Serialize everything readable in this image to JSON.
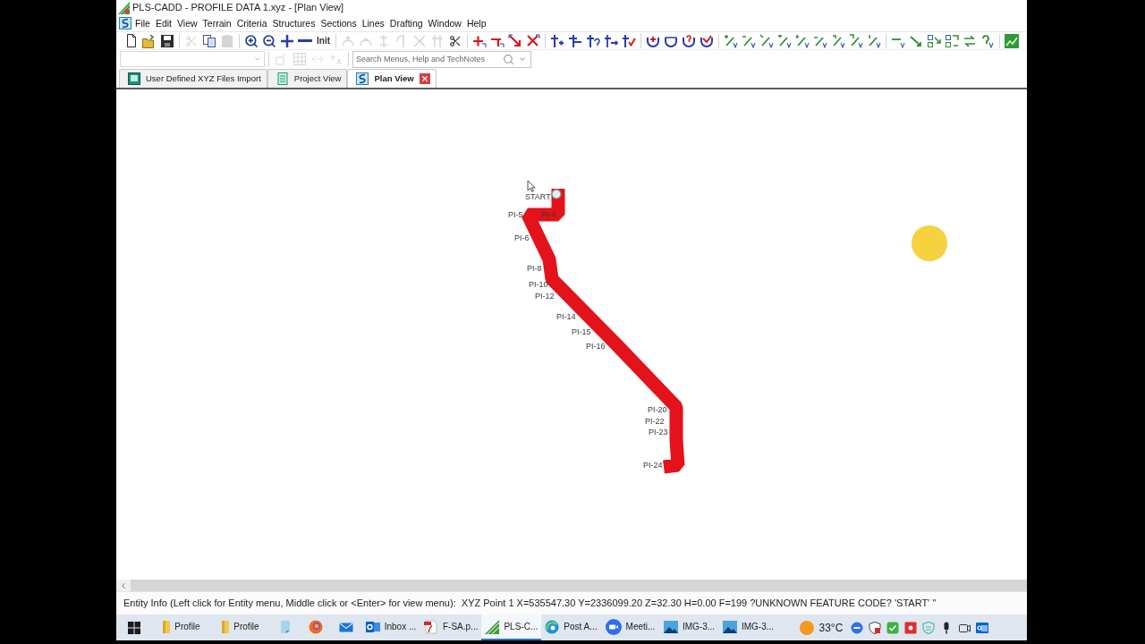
{
  "window": {
    "title": "PLS-CADD - PROFILE DATA 1.xyz - [Plan View]"
  },
  "menu_bar": [
    "File",
    "Edit",
    "View",
    "Terrain",
    "Criteria",
    "Structures",
    "Sections",
    "Lines",
    "Drafting",
    "Window",
    "Help"
  ],
  "toolbar": [
    {
      "kind": "new",
      "disabled": false
    },
    {
      "kind": "open",
      "disabled": false
    },
    {
      "kind": "save",
      "disabled": false
    },
    {
      "kind": "separator"
    },
    {
      "kind": "cut",
      "disabled": true
    },
    {
      "kind": "copy",
      "disabled": false
    },
    {
      "kind": "paste",
      "disabled": true
    },
    {
      "kind": "separator"
    },
    {
      "kind": "zoom-in",
      "disabled": false
    },
    {
      "kind": "zoom-out",
      "disabled": false
    },
    {
      "kind": "add",
      "disabled": false
    },
    {
      "kind": "remove",
      "disabled": false
    },
    {
      "kind": "text",
      "label": "Init",
      "disabled": false
    },
    {
      "kind": "separator"
    },
    {
      "kind": "edit-tool",
      "disabled": true
    },
    {
      "kind": "edit-tool",
      "disabled": true
    },
    {
      "kind": "edit-tool",
      "disabled": true
    },
    {
      "kind": "edit-tool",
      "disabled": true
    },
    {
      "kind": "edit-tool",
      "disabled": true
    },
    {
      "kind": "edit-tool",
      "disabled": true
    },
    {
      "kind": "cut",
      "disabled": false
    },
    {
      "kind": "separator"
    },
    {
      "kind": "pi-tool",
      "disabled": false
    },
    {
      "kind": "pi-tool",
      "disabled": false
    },
    {
      "kind": "pi-tool",
      "disabled": false
    },
    {
      "kind": "pi-tool",
      "disabled": false
    },
    {
      "kind": "separator"
    },
    {
      "kind": "structure-tool",
      "disabled": false
    },
    {
      "kind": "structure-tool",
      "disabled": false
    },
    {
      "kind": "structure-tool",
      "disabled": false
    },
    {
      "kind": "structure-tool",
      "disabled": false
    },
    {
      "kind": "structure-tool",
      "disabled": false
    },
    {
      "kind": "separator"
    },
    {
      "kind": "sag-tool",
      "disabled": false
    },
    {
      "kind": "sag-tool",
      "disabled": false
    },
    {
      "kind": "sag-tool",
      "disabled": false
    },
    {
      "kind": "sag-tool",
      "disabled": false
    },
    {
      "kind": "separator"
    },
    {
      "kind": "label-tool",
      "disabled": false
    },
    {
      "kind": "label-tool",
      "disabled": false
    },
    {
      "kind": "label-tool",
      "disabled": false
    },
    {
      "kind": "label-tool",
      "disabled": false
    },
    {
      "kind": "label-tool",
      "disabled": false
    },
    {
      "kind": "label-tool",
      "disabled": false
    },
    {
      "kind": "label-tool",
      "disabled": false
    },
    {
      "kind": "label-tool",
      "disabled": false
    },
    {
      "kind": "label-tool",
      "disabled": false
    },
    {
      "kind": "separator"
    },
    {
      "kind": "draft-tool",
      "disabled": false
    },
    {
      "kind": "draft-tool",
      "disabled": false
    },
    {
      "kind": "draft-tool",
      "disabled": false
    },
    {
      "kind": "draft-tool",
      "disabled": false
    },
    {
      "kind": "draft-tool",
      "disabled": false
    },
    {
      "kind": "draft-tool",
      "disabled": false
    },
    {
      "kind": "separator"
    },
    {
      "kind": "report",
      "disabled": false
    }
  ],
  "toolbar_2": {
    "items": [
      {
        "kind": "tag-tool",
        "disabled": true
      },
      {
        "kind": "grid",
        "disabled": true
      },
      {
        "kind": "scale",
        "disabled": true
      },
      {
        "kind": "text-tool",
        "disabled": true
      }
    ],
    "search": {
      "placeholder": "Search Menus, Help and TechNotes"
    }
  },
  "tabs": [
    {
      "kind": "import",
      "label": "User Defined XYZ Files Import",
      "selected": false
    },
    {
      "kind": "project",
      "label": "Project View",
      "selected": false
    },
    {
      "kind": "plan",
      "label": "Plan View",
      "selected": true
    }
  ],
  "plan_view": {
    "labels": [
      "START",
      "PI-5",
      "PI-4",
      "PI-6",
      "PI-8",
      "PI-10",
      "PI-12",
      "PI-14",
      "PI-15",
      "PI-16",
      "PI-20",
      "PI-22",
      "PI-23",
      "PI-24"
    ]
  },
  "status_bar": {
    "text": "Entity Info (Left click for Entity menu, Middle click or <Enter> for view menu):  XYZ Point 1 X=535547.30 Y=2336099.20 Z=32.30 H=0.00 F=199 ?UNKNOWN FEATURE CODE? 'START' ''"
  },
  "taskbar": {
    "apps": [
      {
        "kind": "folder",
        "label": "Profile",
        "selected": false
      },
      {
        "kind": "folder",
        "label": "Profile",
        "selected": false
      },
      {
        "kind": "notes",
        "selected": false
      },
      {
        "kind": "browser",
        "selected": false
      },
      {
        "kind": "mail",
        "selected": false
      },
      {
        "kind": "outlook",
        "label": "Inbox ...",
        "selected": false
      },
      {
        "kind": "pdf",
        "label": "F-SA.p...",
        "selected": false
      },
      {
        "kind": "cad",
        "label": "PLS-C...",
        "selected": true
      },
      {
        "kind": "edge",
        "label": "Post A...",
        "selected": false
      },
      {
        "kind": "meeting",
        "label": "Meeti...",
        "selected": false
      },
      {
        "kind": "image",
        "label": "IMG-3...",
        "selected": false
      },
      {
        "kind": "image",
        "label": "IMG-3...",
        "selected": false
      }
    ],
    "weather": {
      "temperature": "33°C"
    }
  }
}
